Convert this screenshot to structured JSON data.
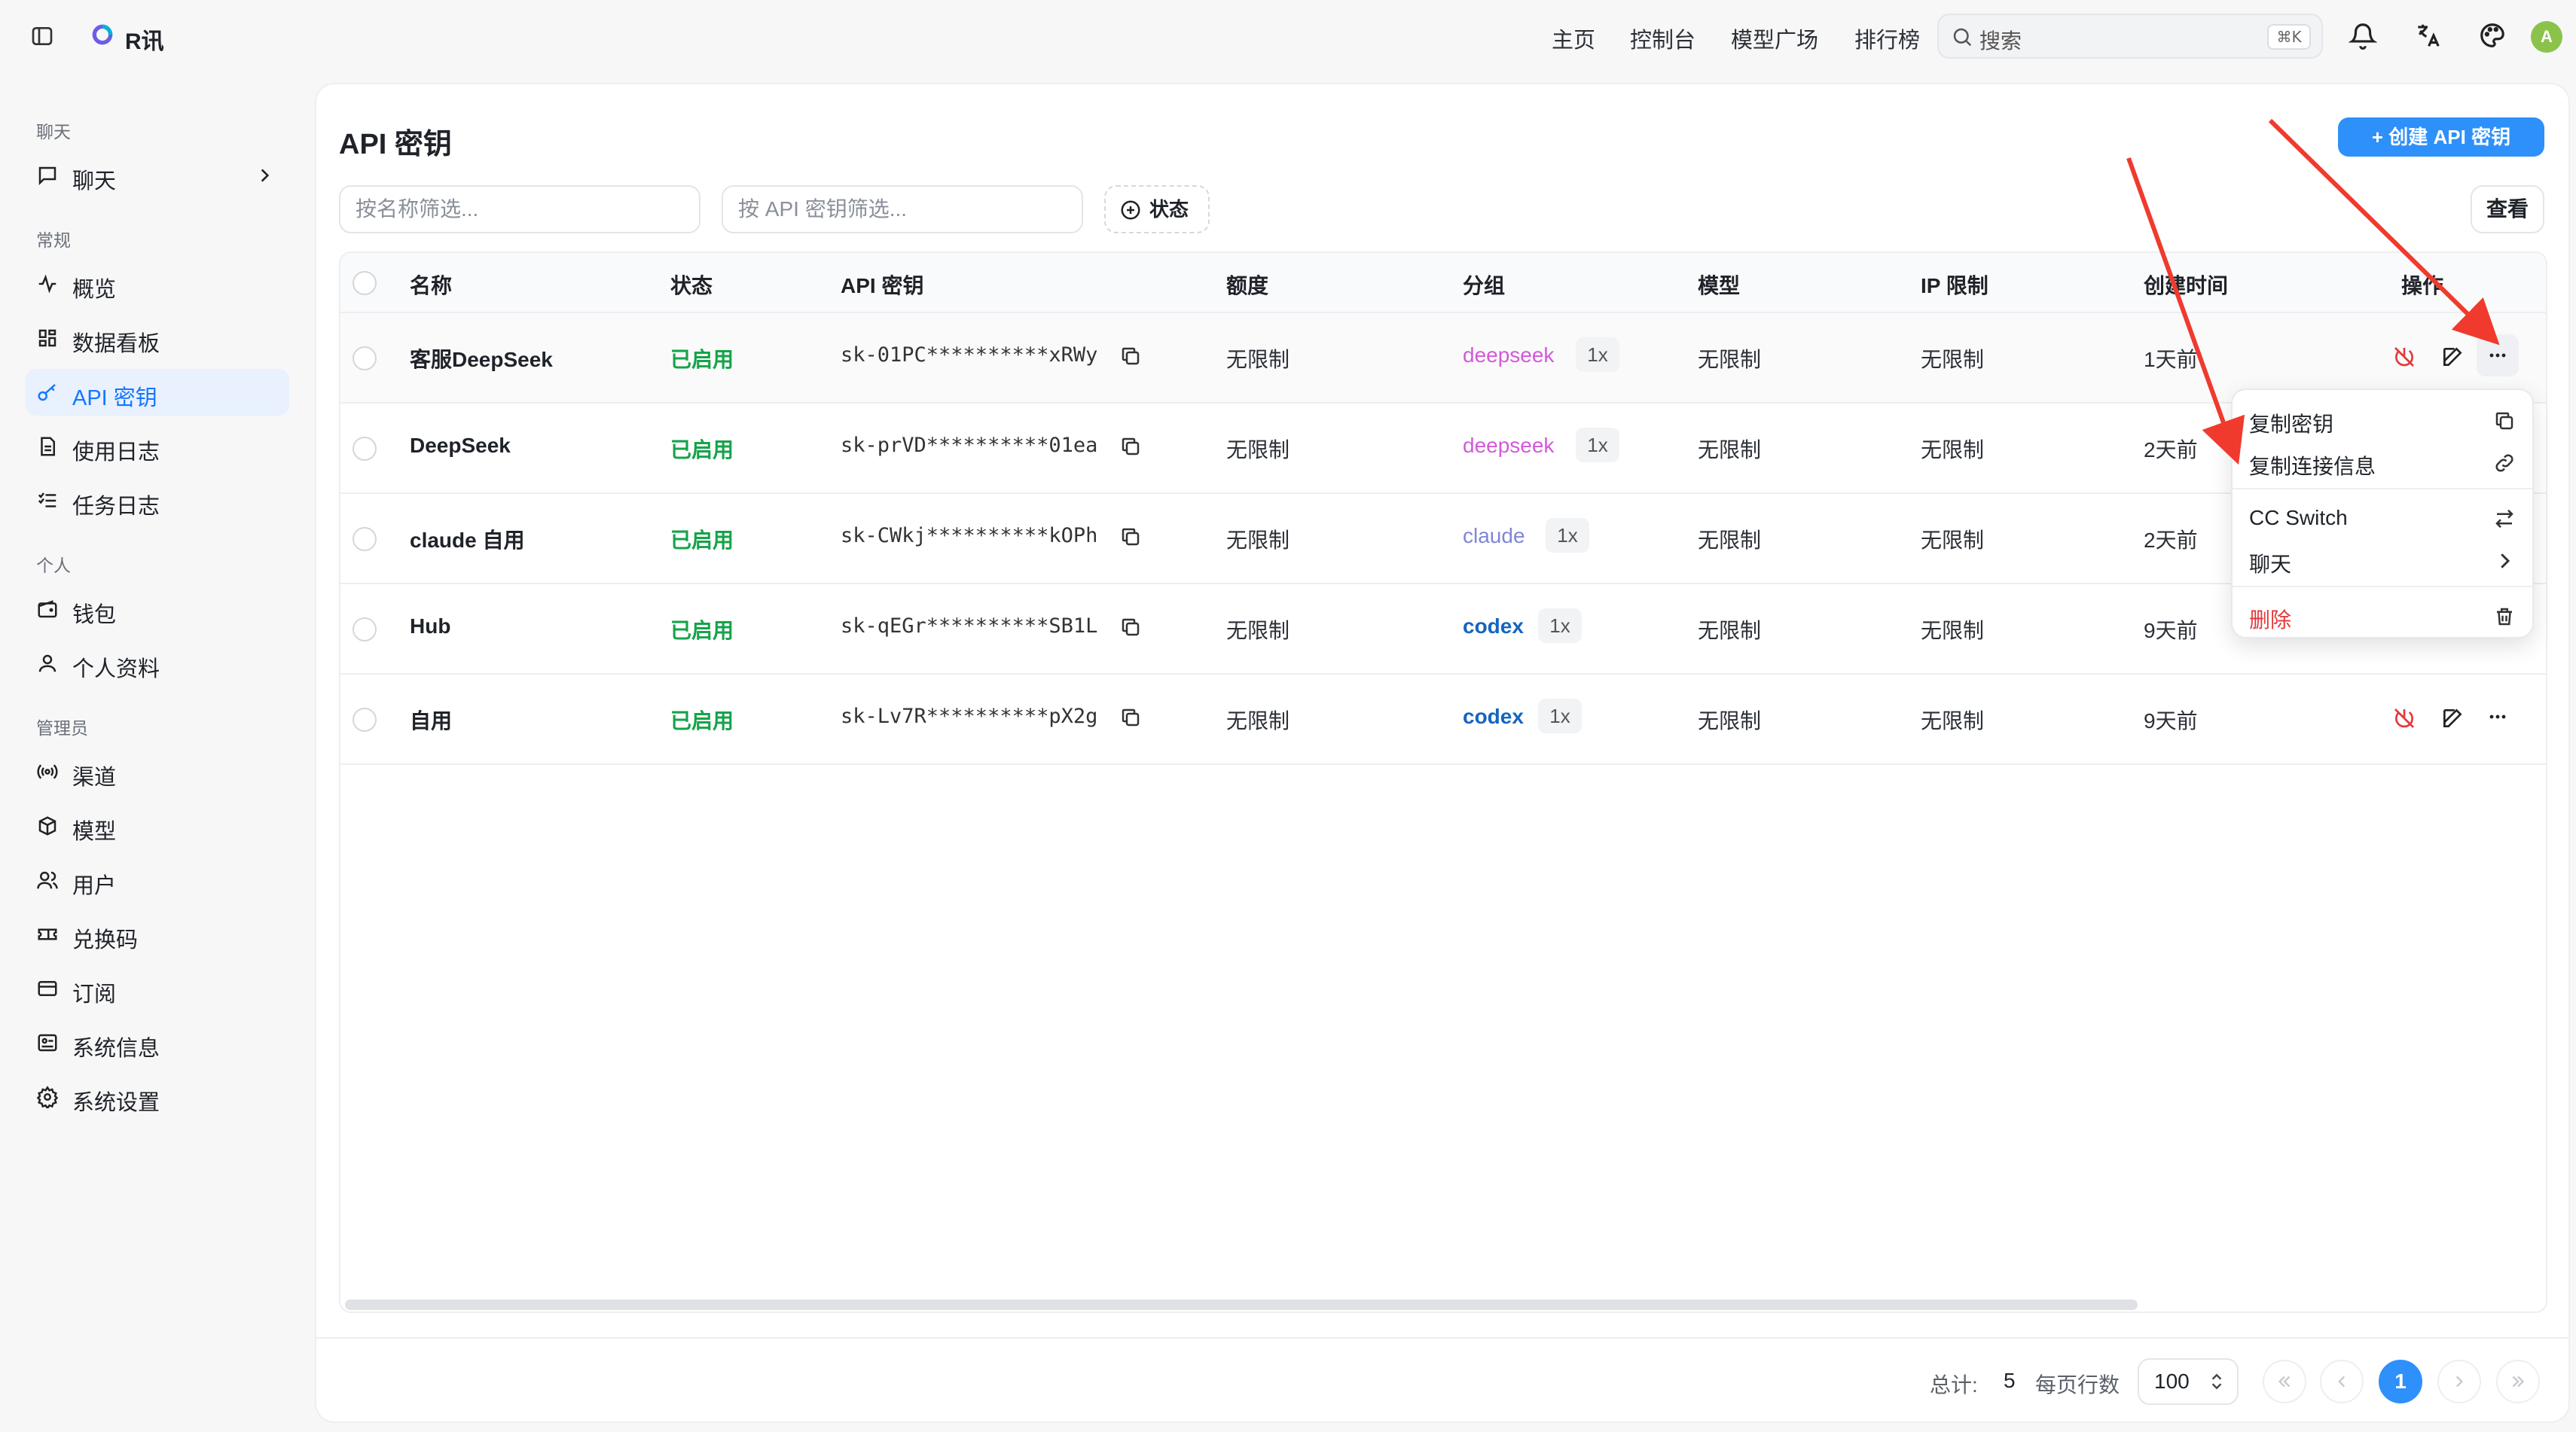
{
  "app": {
    "name": "R讯",
    "brand_color": "#2e90fa",
    "avatar_initial": "A"
  },
  "topnav": {
    "links": [
      "主页",
      "控制台",
      "模型广场",
      "排行榜"
    ],
    "search_placeholder": "搜索",
    "search_shortcut": "⌘K"
  },
  "sidebar": {
    "sections": [
      {
        "title": "聊天",
        "items": [
          {
            "label": "聊天",
            "icon": "message-square-icon",
            "chevron": true
          }
        ]
      },
      {
        "title": "常规",
        "items": [
          {
            "label": "概览",
            "icon": "activity-icon"
          },
          {
            "label": "数据看板",
            "icon": "grid-icon"
          },
          {
            "label": "API 密钥",
            "icon": "key-icon",
            "active": true
          },
          {
            "label": "使用日志",
            "icon": "file-text-icon"
          },
          {
            "label": "任务日志",
            "icon": "list-checks-icon"
          }
        ]
      },
      {
        "title": "个人",
        "items": [
          {
            "label": "钱包",
            "icon": "wallet-icon"
          },
          {
            "label": "个人资料",
            "icon": "user-icon"
          }
        ]
      },
      {
        "title": "管理员",
        "items": [
          {
            "label": "渠道",
            "icon": "radio-icon"
          },
          {
            "label": "模型",
            "icon": "box-icon"
          },
          {
            "label": "用户",
            "icon": "users-icon"
          },
          {
            "label": "兑换码",
            "icon": "ticket-icon"
          },
          {
            "label": "订阅",
            "icon": "credit-card-icon"
          },
          {
            "label": "系统信息",
            "icon": "info-icon"
          },
          {
            "label": "系统设置",
            "icon": "settings-icon"
          }
        ]
      }
    ]
  },
  "page": {
    "title": "API 密钥",
    "create_button": "+ 创建 API 密钥",
    "filter_name_placeholder": "按名称筛选...",
    "filter_key_placeholder": "按 API 密钥筛选...",
    "status_filter": "状态",
    "view_button": "查看"
  },
  "table": {
    "columns": [
      "名称",
      "状态",
      "API 密钥",
      "额度",
      "分组",
      "模型",
      "IP 限制",
      "创建时间",
      "操作"
    ],
    "rows": [
      {
        "name": "客服DeepSeek",
        "status": "已启用",
        "key": "sk-01PC**********xRWy",
        "quota": "无限制",
        "group": "deepseek",
        "ratio": "1x",
        "models": "无限制",
        "ip": "无限制",
        "created": "1天前"
      },
      {
        "name": "DeepSeek",
        "status": "已启用",
        "key": "sk-prVD**********01ea",
        "quota": "无限制",
        "group": "deepseek",
        "ratio": "1x",
        "models": "无限制",
        "ip": "无限制",
        "created": "2天前"
      },
      {
        "name": "claude 自用",
        "status": "已启用",
        "key": "sk-CWkj**********kOPh",
        "quota": "无限制",
        "group": "claude",
        "ratio": "1x",
        "models": "无限制",
        "ip": "无限制",
        "created": "2天前"
      },
      {
        "name": "Hub",
        "status": "已启用",
        "key": "sk-qEGr**********SB1L",
        "quota": "无限制",
        "group": "codex",
        "ratio": "1x",
        "models": "无限制",
        "ip": "无限制",
        "created": "9天前"
      },
      {
        "name": "自用",
        "status": "已启用",
        "key": "sk-Lv7R**********pX2g",
        "quota": "无限制",
        "group": "codex",
        "ratio": "1x",
        "models": "无限制",
        "ip": "无限制",
        "created": "9天前"
      }
    ]
  },
  "menu": {
    "items": [
      "复制密钥",
      "复制连接信息",
      "CC Switch",
      "聊天",
      "删除"
    ]
  },
  "footer": {
    "total_label": "总计:",
    "total_value": "5",
    "per_page_label": "每页行数",
    "per_page_value": "100",
    "current_page": "1"
  }
}
